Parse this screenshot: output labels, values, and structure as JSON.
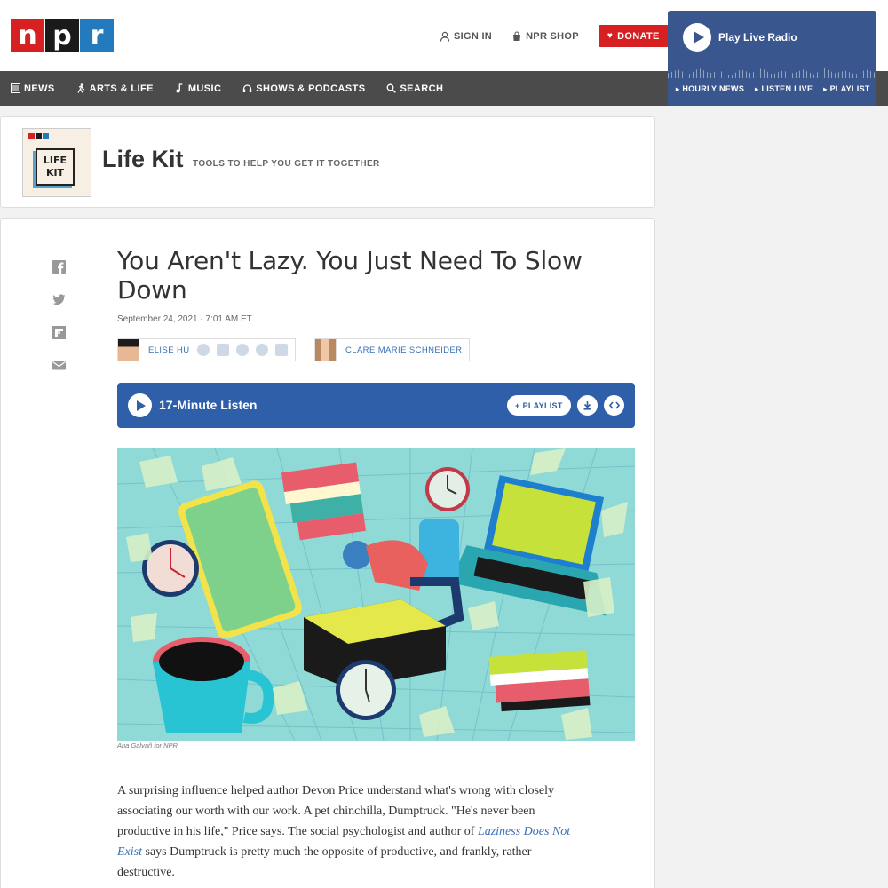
{
  "brand": {
    "logo_letters": [
      "n",
      "p",
      "r"
    ]
  },
  "topbar": {
    "sign_in": "SIGN IN",
    "shop": "NPR SHOP",
    "donate": "DONATE"
  },
  "nav": {
    "items": [
      "NEWS",
      "ARTS & LIFE",
      "MUSIC",
      "SHOWS & PODCASTS",
      "SEARCH"
    ]
  },
  "player": {
    "title": "Play Live Radio",
    "links": [
      "HOURLY NEWS",
      "LISTEN LIVE",
      "PLAYLIST"
    ]
  },
  "show": {
    "logo_lines": [
      "LIFE",
      "KIT"
    ],
    "name": "Life Kit",
    "tagline": "TOOLS TO HELP YOU GET IT TOGETHER"
  },
  "article": {
    "headline": "You Aren't Lazy. You Just Need To Slow Down",
    "date": "September 24, 2021 · 7:01 AM ET",
    "authors": [
      "ELISE HU",
      "CLARE MARIE SCHNEIDER"
    ],
    "listen_label": "17-Minute Listen",
    "playlist_label": "PLAYLIST",
    "image_credit": "Ana Galvañ for NPR",
    "body": {
      "p1_a": "A surprising influence helped author Devon Price understand what's wrong with closely associating our worth with our work. A pet chinchilla, Dumptruck. \"He's never been productive in his life,\" Price says. The social psychologist and author of ",
      "p1_link": "Laziness Does Not Exist",
      "p1_b": " says Dumptruck is pretty much the opposite of productive, and frankly, rather destructive."
    }
  },
  "colors": {
    "npr_red": "#d62021",
    "npr_black": "#1a1a1a",
    "npr_blue": "#237bbd",
    "nav_bg": "#4b4b4b",
    "player_bg": "#3a568f",
    "listen_bg": "#2f5fa8",
    "link": "#3a6fb7"
  }
}
